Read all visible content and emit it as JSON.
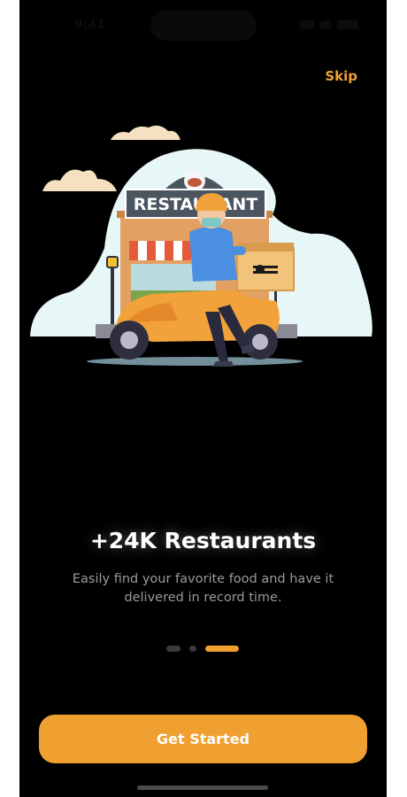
{
  "status_bar": {
    "time": "9:41"
  },
  "onboarding": {
    "skip_label": "Skip",
    "illustration": {
      "sign_text": "RESTAURANT"
    },
    "title": "+24K Restaurants",
    "subtitle": "Easily find your favorite food and have it delivered in record time.",
    "page_indicator": {
      "total_pages": 3,
      "current_page": 3
    },
    "cta_label": "Get Started"
  },
  "colors": {
    "background": "#000000",
    "accent": "#f0a030",
    "title": "#ffffff",
    "subtitle": "#9a9a9a",
    "inactive_dot": "#3a3a3a"
  }
}
